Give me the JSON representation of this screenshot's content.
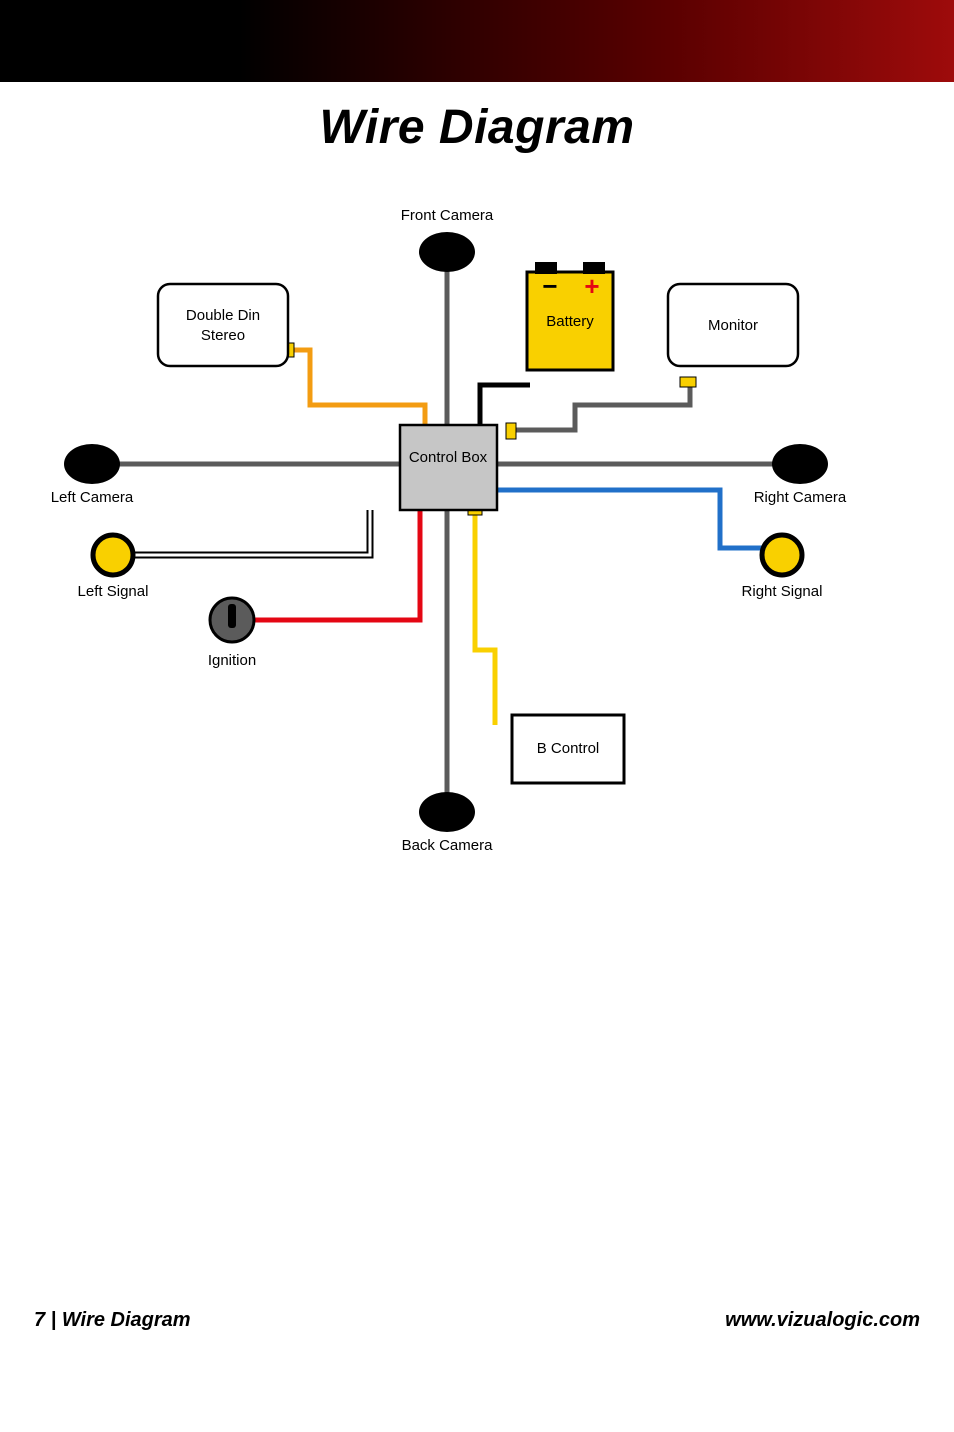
{
  "page_title": "Wire Diagram",
  "footer_page": "7 | Wire Diagram",
  "footer_url": "www.vizualogic.com",
  "components": {
    "control_box": {
      "label": "Control Box"
    },
    "front_camera": {
      "label": "Front Camera"
    },
    "back_camera": {
      "label": "Back Camera"
    },
    "left_camera": {
      "label": "Left Camera"
    },
    "right_camera": {
      "label": "Right Camera"
    },
    "left_signal": {
      "label": "Left Signal"
    },
    "right_signal": {
      "label": "Right Signal"
    },
    "double_din": {
      "label_line1": "Double Din",
      "label_line2": "Stereo"
    },
    "monitor": {
      "label": "Monitor"
    },
    "battery": {
      "label": "Battery"
    },
    "ignition": {
      "label": "Ignition"
    },
    "b_control": {
      "label": "B Control"
    }
  },
  "wires": {
    "stereo_to_ctrl": {
      "color": "#f39c12"
    },
    "battery_to_ctrl": {
      "color": "#000000"
    },
    "monitor_to_ctrl": {
      "color": "#5b5b5b"
    },
    "ignition_to_ctrl": {
      "color": "#e40613"
    },
    "bcontrol_to_ctrl": {
      "color": "#f9d000"
    },
    "left_signal_wire": {
      "color": "#000000",
      "shielded": true
    },
    "right_signal_wire": {
      "color": "#2170c9"
    },
    "cameras": {
      "color": "#5b5b5b"
    }
  }
}
